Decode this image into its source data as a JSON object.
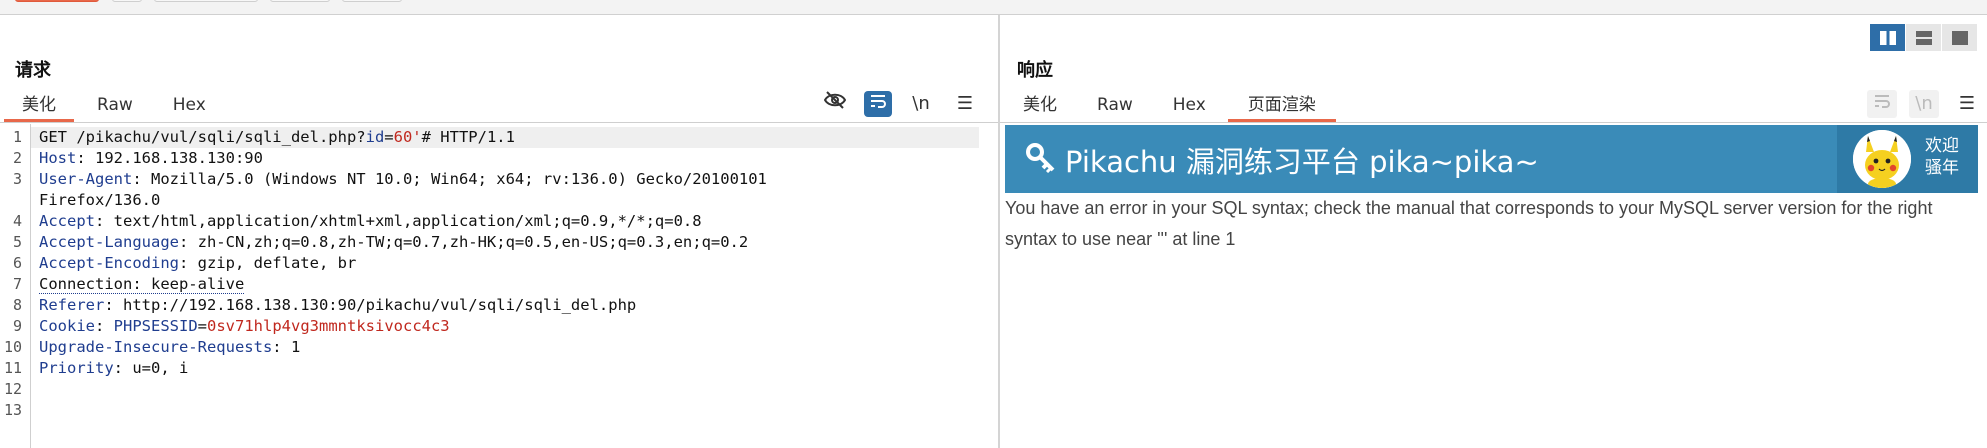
{
  "request": {
    "title": "请求",
    "tabs": [
      "美化",
      "Raw",
      "Hex"
    ],
    "active_tab": "美化",
    "toolbar": {
      "newline_label": "\\n",
      "menu_label": "☰"
    },
    "lines": [
      {
        "n": "1",
        "parts": [
          [
            "GET /pikachu/vul/sqli/sqli_del.php?",
            "plain"
          ],
          [
            "id",
            "pname"
          ],
          [
            "=",
            "plain"
          ],
          [
            "60'",
            "pval"
          ],
          [
            "# HTTP/1.1",
            "plain"
          ]
        ]
      },
      {
        "n": "2",
        "parts": [
          [
            "Host",
            "hname"
          ],
          [
            ": 192.168.138.130:90",
            "plain"
          ]
        ]
      },
      {
        "n": "3",
        "parts": [
          [
            "User-Agent",
            "hname"
          ],
          [
            ": Mozilla/5.0 (Windows NT 10.0; Win64; x64; rv:136.0) Gecko/20100101",
            "plain"
          ]
        ]
      },
      {
        "n": "",
        "parts": [
          [
            "Firefox/136.0",
            "plain"
          ]
        ]
      },
      {
        "n": "4",
        "parts": [
          [
            "Accept",
            "hname"
          ],
          [
            ": text/html,application/xhtml+xml,application/xml;q=0.9,*/*;q=0.8",
            "plain"
          ]
        ]
      },
      {
        "n": "5",
        "parts": [
          [
            "Accept-Language",
            "hname"
          ],
          [
            ": zh-CN,zh;q=0.8,zh-TW;q=0.7,zh-HK;q=0.5,en-US;q=0.3,en;q=0.2",
            "plain"
          ]
        ]
      },
      {
        "n": "6",
        "parts": [
          [
            "Accept-Encoding",
            "hname"
          ],
          [
            ": gzip, deflate, br",
            "plain"
          ]
        ]
      },
      {
        "n": "7",
        "parts": [
          [
            "Connection: keep-alive",
            "dotted"
          ]
        ]
      },
      {
        "n": "8",
        "parts": [
          [
            "Referer",
            "hname"
          ],
          [
            ": http://192.168.138.130:90/pikachu/vul/sqli/sqli_del.php",
            "plain"
          ]
        ]
      },
      {
        "n": "9",
        "parts": [
          [
            "Cookie",
            "hname"
          ],
          [
            ": ",
            "plain"
          ],
          [
            "PHPSESSID",
            "pname"
          ],
          [
            "=",
            "plain"
          ],
          [
            "0sv71hlp4vg3mmntksivocc4c3",
            "pval"
          ]
        ]
      },
      {
        "n": "10",
        "parts": [
          [
            "Upgrade-Insecure-Requests",
            "hname"
          ],
          [
            ": 1",
            "plain"
          ]
        ]
      },
      {
        "n": "11",
        "parts": [
          [
            "Priority",
            "hname"
          ],
          [
            ": u=0, i",
            "plain"
          ]
        ]
      },
      {
        "n": "12",
        "parts": []
      },
      {
        "n": "13",
        "parts": []
      }
    ]
  },
  "response": {
    "title": "响应",
    "tabs": [
      "美化",
      "Raw",
      "Hex",
      "页面渲染"
    ],
    "active_tab": "页面渲染",
    "toolbar": {
      "newline_label": "\\n",
      "menu_label": "☰"
    },
    "render": {
      "banner_title": "Pikachu 漏洞练习平台 pika~pika~",
      "welcome_line1": "欢迎",
      "welcome_line2": "骚年",
      "error_message": "You have an error in your SQL syntax; check the manual that corresponds to your MySQL server version for the right syntax to use near ''' at line 1"
    }
  },
  "colors": {
    "accent": "#e8684a",
    "toolbar_blue": "#2e6ea8",
    "banner_blue": "#3a8bb8",
    "header_name": "#1f3d8f",
    "param_value": "#c0281e"
  }
}
